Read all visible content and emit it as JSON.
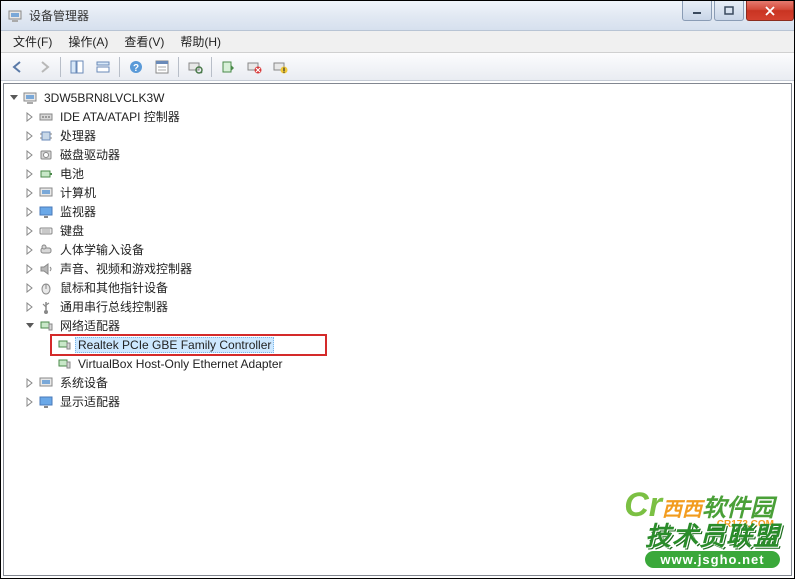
{
  "window": {
    "title": "设备管理器"
  },
  "menu": {
    "file": "文件(F)",
    "action": "操作(A)",
    "view": "查看(V)",
    "help": "帮助(H)"
  },
  "tree": {
    "root": "3DW5BRN8LVCLK3W",
    "items": [
      "IDE ATA/ATAPI 控制器",
      "处理器",
      "磁盘驱动器",
      "电池",
      "计算机",
      "监视器",
      "键盘",
      "人体学输入设备",
      "声音、视频和游戏控制器",
      "鼠标和其他指针设备",
      "通用串行总线控制器",
      "网络适配器",
      "系统设备",
      "显示适配器"
    ],
    "network_children": [
      "Realtek PCIe GBE Family Controller",
      "VirtualBox Host-Only Ethernet Adapter"
    ]
  },
  "watermark": {
    "line1a": "西西",
    "line1b": "软件园",
    "line1small": "CR173.COM",
    "line2": "技术员联盟",
    "url": "www.jsgho.net"
  }
}
